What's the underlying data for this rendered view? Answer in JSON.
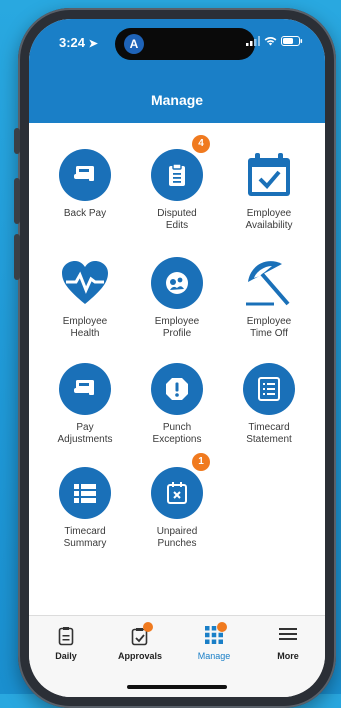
{
  "status_bar": {
    "time": "3:24",
    "island_app_glyph": "A"
  },
  "header": {
    "title": "Manage"
  },
  "tiles": [
    {
      "id": "back-pay",
      "label": "Back Pay",
      "icon": "money-hand-icon",
      "badge": null
    },
    {
      "id": "disputed-edits",
      "label": "Disputed\nEdits",
      "icon": "clipboard-icon",
      "badge": "4"
    },
    {
      "id": "employee-availability",
      "label": "Employee\nAvailability",
      "icon": "calendar-check-icon",
      "badge": null
    },
    {
      "id": "employee-health",
      "label": "Employee\nHealth",
      "icon": "heart-pulse-icon",
      "badge": null
    },
    {
      "id": "employee-profile",
      "label": "Employee\nProfile",
      "icon": "profile-icon",
      "badge": null
    },
    {
      "id": "employee-time-off",
      "label": "Employee\nTime Off",
      "icon": "beach-umbrella-icon",
      "badge": null
    },
    {
      "id": "pay-adjustments",
      "label": "Pay\nAdjustments",
      "icon": "money-hand-icon",
      "badge": null
    },
    {
      "id": "punch-exceptions",
      "label": "Punch\nExceptions",
      "icon": "alert-icon",
      "badge": null
    },
    {
      "id": "timecard-statement",
      "label": "Timecard\nStatement",
      "icon": "document-list-icon",
      "badge": null
    },
    {
      "id": "timecard-summary",
      "label": "Timecard\nSummary",
      "icon": "list-icon",
      "badge": null
    },
    {
      "id": "unpaired-punches",
      "label": "Unpaired\nPunches",
      "icon": "calendar-x-icon",
      "badge": "1"
    }
  ],
  "tabs": [
    {
      "id": "daily",
      "label": "Daily",
      "icon": "daily-icon",
      "badge": false,
      "active": false
    },
    {
      "id": "approvals",
      "label": "Approvals",
      "icon": "approvals-icon",
      "badge": true,
      "active": false
    },
    {
      "id": "manage",
      "label": "Manage",
      "icon": "grid-icon",
      "badge": true,
      "active": true
    },
    {
      "id": "more",
      "label": "More",
      "icon": "menu-icon",
      "badge": false,
      "active": false
    }
  ],
  "colors": {
    "brand_blue": "#1a7fc7",
    "icon_blue": "#1a70b8",
    "badge_orange": "#f07a1f",
    "background_blue": "#29a8e0"
  }
}
